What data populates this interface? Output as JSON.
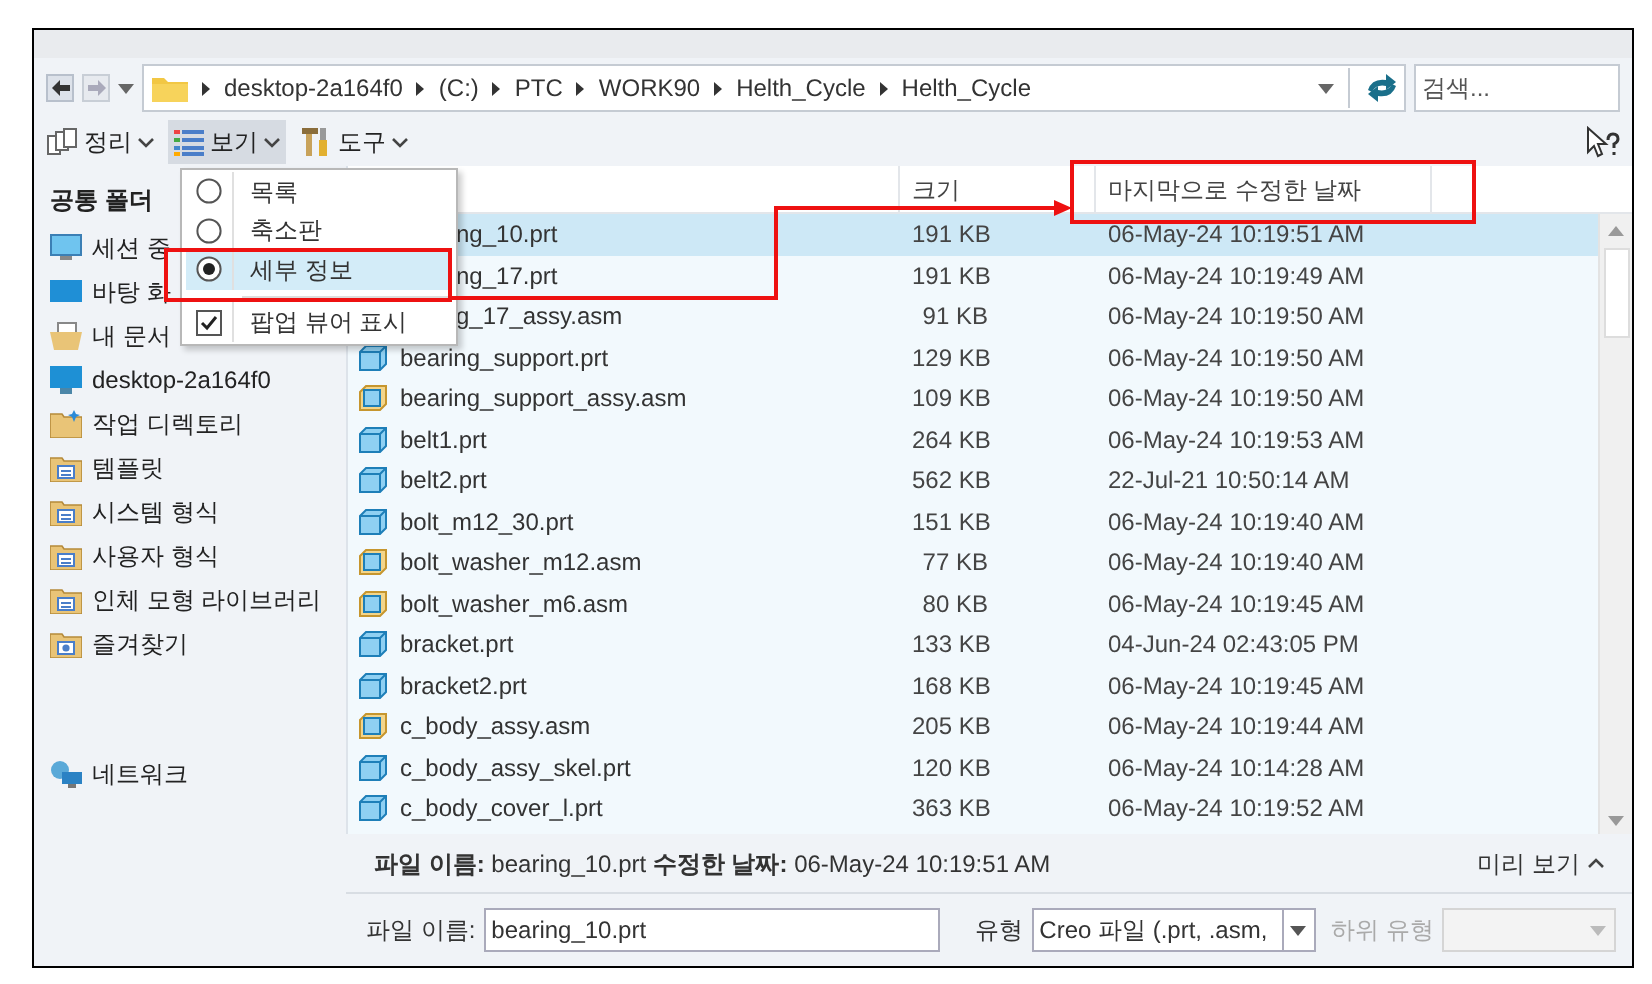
{
  "address_bar": {
    "segments": [
      "desktop-2a164f0",
      "(C:)",
      "PTC",
      "WORK90",
      "Helth_Cycle",
      "Helth_Cycle"
    ],
    "search_placeholder": "검색..."
  },
  "toolbar": [
    {
      "label": "정리",
      "kind": "organize",
      "selected": false
    },
    {
      "label": "보기",
      "kind": "view",
      "selected": true
    },
    {
      "label": "도구",
      "kind": "tools",
      "selected": false
    }
  ],
  "sidebar": {
    "heading": "공통 폴더",
    "items": [
      {
        "label": "세션 중",
        "kind": "monitor"
      },
      {
        "label": "바탕 화",
        "kind": "desktop"
      },
      {
        "label": "내 문서",
        "kind": "documents"
      },
      {
        "label": "desktop-2a164f0",
        "kind": "computer"
      },
      {
        "label": "작업 디렉토리",
        "kind": "workdir"
      },
      {
        "label": "템플릿",
        "kind": "folder"
      },
      {
        "label": "시스템 형식",
        "kind": "folder"
      },
      {
        "label": "사용자 형식",
        "kind": "folder"
      },
      {
        "label": "인체 모형 라이브러리",
        "kind": "folder"
      },
      {
        "label": "즐겨찾기",
        "kind": "favorites"
      },
      {
        "label": "네트워크",
        "kind": "network"
      }
    ]
  },
  "view_menu": [
    {
      "label": "목록",
      "kind": "radio",
      "selected": false
    },
    {
      "label": "축소판",
      "kind": "radio",
      "selected": false
    },
    {
      "label": "세부 정보",
      "kind": "radio",
      "selected": true
    },
    {
      "label": "팝업 뷰어 표시",
      "kind": "check",
      "checked": true
    }
  ],
  "table": {
    "columns": [
      "크기",
      "마지막으로 수정한 날짜"
    ],
    "rows": [
      {
        "name": "ng_10.prt",
        "kind": "covered",
        "size": "191 KB",
        "date": "06-May-24 10:19:51 AM",
        "selected": true
      },
      {
        "name": "ng_17.prt",
        "kind": "covered",
        "size": "191 KB",
        "date": "06-May-24 10:19:49 AM",
        "selected": false
      },
      {
        "name": "g_17_assy.asm",
        "kind": "covered",
        "size": "91 KB",
        "date": "06-May-24 10:19:50 AM",
        "selected": false
      },
      {
        "name": "bearing_support.prt",
        "kind": "prt",
        "size": "129 KB",
        "date": "06-May-24 10:19:50 AM",
        "selected": false
      },
      {
        "name": "bearing_support_assy.asm",
        "kind": "asm",
        "size": "109 KB",
        "date": "06-May-24 10:19:50 AM",
        "selected": false
      },
      {
        "name": "belt1.prt",
        "kind": "prt",
        "size": "264 KB",
        "date": "06-May-24 10:19:53 AM",
        "selected": false
      },
      {
        "name": "belt2.prt",
        "kind": "prt",
        "size": "562 KB",
        "date": "22-Jul-21 10:50:14 AM",
        "selected": false
      },
      {
        "name": "bolt_m12_30.prt",
        "kind": "prt",
        "size": "151 KB",
        "date": "06-May-24 10:19:40 AM",
        "selected": false
      },
      {
        "name": "bolt_washer_m12.asm",
        "kind": "asm",
        "size": "77 KB",
        "date": "06-May-24 10:19:40 AM",
        "selected": false
      },
      {
        "name": "bolt_washer_m6.asm",
        "kind": "asm",
        "size": "80 KB",
        "date": "06-May-24 10:19:45 AM",
        "selected": false
      },
      {
        "name": "bracket.prt",
        "kind": "prt",
        "size": "133 KB",
        "date": "04-Jun-24 02:43:05 PM",
        "selected": false
      },
      {
        "name": "bracket2.prt",
        "kind": "prt",
        "size": "168 KB",
        "date": "06-May-24 10:19:45 AM",
        "selected": false
      },
      {
        "name": "c_body_assy.asm",
        "kind": "asm",
        "size": "205 KB",
        "date": "06-May-24 10:19:44 AM",
        "selected": false
      },
      {
        "name": "c_body_assy_skel.prt",
        "kind": "prt",
        "size": "120 KB",
        "date": "06-May-24 10:14:28 AM",
        "selected": false
      },
      {
        "name": "c_body_cover_l.prt",
        "kind": "prt",
        "size": "363 KB",
        "date": "06-May-24 10:19:52 AM",
        "selected": false
      }
    ]
  },
  "info_bar": {
    "text": "**파일 이름:** bearing_10.prt **수정한 날짜:** 06-May-24 10:19:51 AM",
    "preview": "미리 보기"
  },
  "file_row": {
    "name_label": "파일 이름:",
    "name_value": "bearing_10.prt",
    "type_label": "유형",
    "type_value": "Creo 파일 (.prt, .asm,",
    "subtype_label": "하위 유형",
    "subtype_disabled": true
  }
}
